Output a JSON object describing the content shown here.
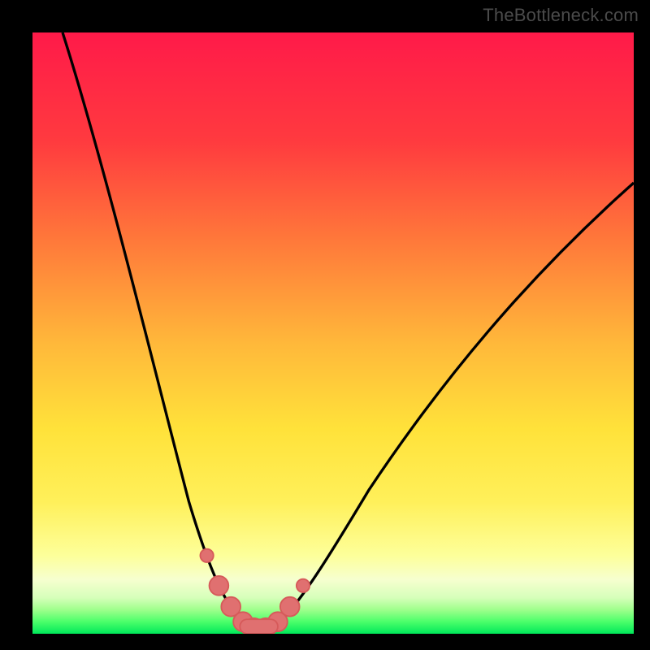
{
  "watermark": "TheBottleneck.com",
  "colors": {
    "top": "#ff1744",
    "mid_upper": "#ff8a3d",
    "mid": "#ffd83a",
    "mid_lower": "#fff36a",
    "pale": "#fdffb0",
    "green_pale": "#c9ffa0",
    "green": "#00ff66",
    "curve": "#000000",
    "marker_fill": "#e06a6a",
    "marker_stroke": "#d65555"
  },
  "chart_data": {
    "type": "line",
    "title": "",
    "xlabel": "",
    "ylabel": "",
    "xlim": [
      0,
      100
    ],
    "ylim": [
      0,
      100
    ],
    "series": [
      {
        "name": "bottleneck-curve",
        "x": [
          5,
          8,
          11,
          14,
          17,
          20,
          23,
          26,
          28,
          30,
          32,
          34,
          36,
          38,
          40,
          44,
          48,
          52,
          56,
          60,
          65,
          70,
          75,
          80,
          85,
          90,
          95,
          100
        ],
        "y": [
          100,
          88,
          76,
          64,
          52,
          41,
          31,
          22,
          16,
          11,
          7,
          4,
          2,
          1,
          1,
          3,
          7,
          13,
          19,
          26,
          34,
          41,
          48,
          54,
          60,
          65,
          70,
          75
        ]
      }
    ],
    "markers": {
      "name": "highlight-points",
      "x": [
        29,
        31,
        33,
        35,
        36.5,
        38.5,
        40.5,
        42.5,
        45
      ],
      "y": [
        13,
        8,
        4.5,
        2,
        1,
        1,
        2,
        4.5,
        8
      ]
    }
  }
}
